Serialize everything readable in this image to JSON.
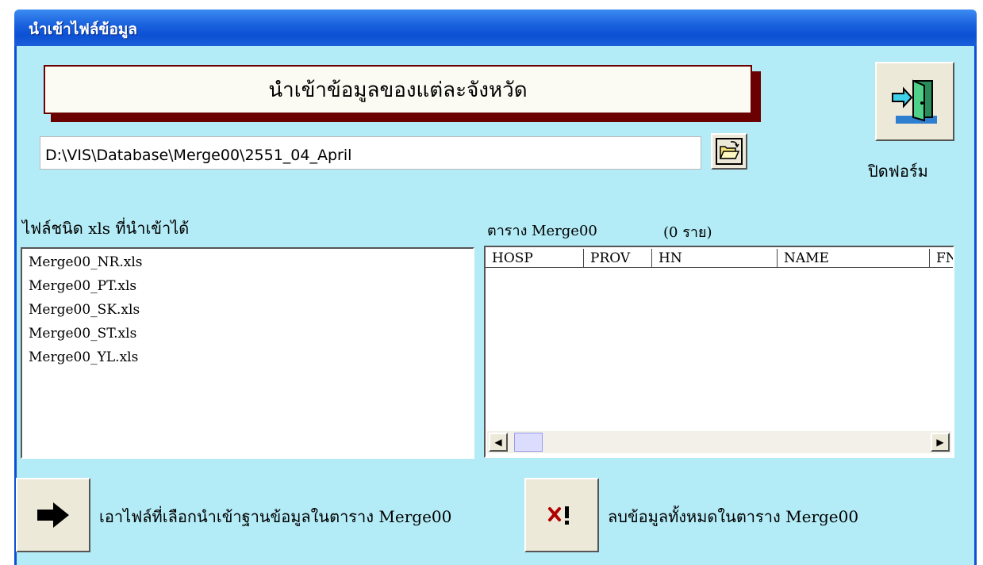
{
  "window": {
    "title": "นำเข้าไฟล์ข้อมูล"
  },
  "heading": "นำเข้าข้อมูลของแต่ละจังหวัด",
  "path_field": {
    "value": "D:\\VIS\\Database\\Merge00\\2551_04_April"
  },
  "exit": {
    "label": "ปิดฟอร์ม",
    "icon": "exit-door-icon"
  },
  "browse": {
    "icon": "open-folder-icon"
  },
  "files": {
    "label": "ไฟล์ชนิด xls ที่นำเข้าได้",
    "items": [
      "Merge00_NR.xls",
      "Merge00_PT.xls",
      "Merge00_SK.xls",
      "Merge00_ST.xls",
      "Merge00_YL.xls"
    ]
  },
  "table": {
    "label": "ตาราง Merge00",
    "count": "(0 ราย)",
    "columns": [
      "HOSP",
      "PROV",
      "HN",
      "NAME",
      "FN"
    ]
  },
  "import": {
    "label": "เอาไฟล์ที่เลือกนำเข้าฐานข้อมูลในตาราง Merge00",
    "icon": "right-arrow-icon"
  },
  "delete": {
    "label": "ลบข้อมูลทั้งหมดในตาราง Merge00",
    "icon": "delete-x-icon"
  },
  "colors": {
    "background": "#b3ecf7",
    "titlebar": "#0c50d4",
    "heading_border": "#6b0000",
    "button_face": "#ece9d8"
  }
}
